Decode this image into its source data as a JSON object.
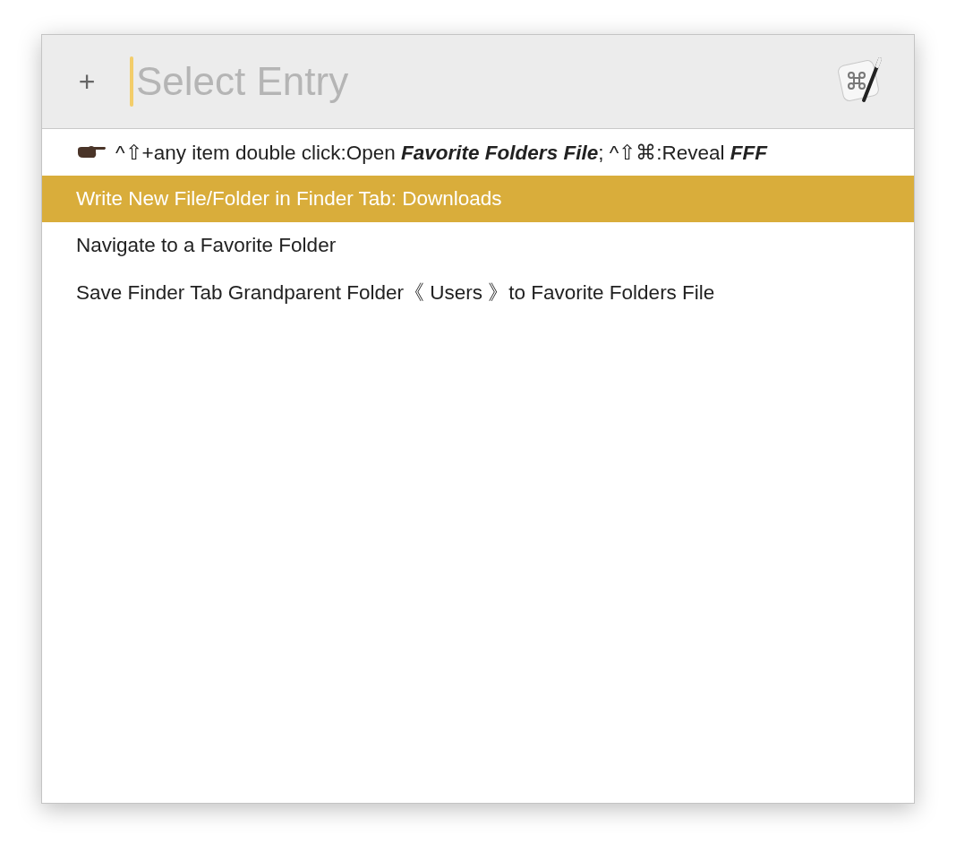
{
  "search": {
    "add_button": "+",
    "placeholder": "Select Entry"
  },
  "items": [
    {
      "kind": "hint",
      "text": "^⇧+any item double click:Open **Favorite Folders File**; ^⇧⌘:Reveal **FFF**",
      "selected": false
    },
    {
      "kind": "entry",
      "text": "Write New File/Folder in Finder Tab: Downloads",
      "selected": true
    },
    {
      "kind": "entry",
      "text": "Navigate to a Favorite Folder",
      "selected": false
    },
    {
      "kind": "entry",
      "text": "Save Finder Tab Grandparent Folder《 Users 》to Favorite Folders File",
      "selected": false
    }
  ]
}
